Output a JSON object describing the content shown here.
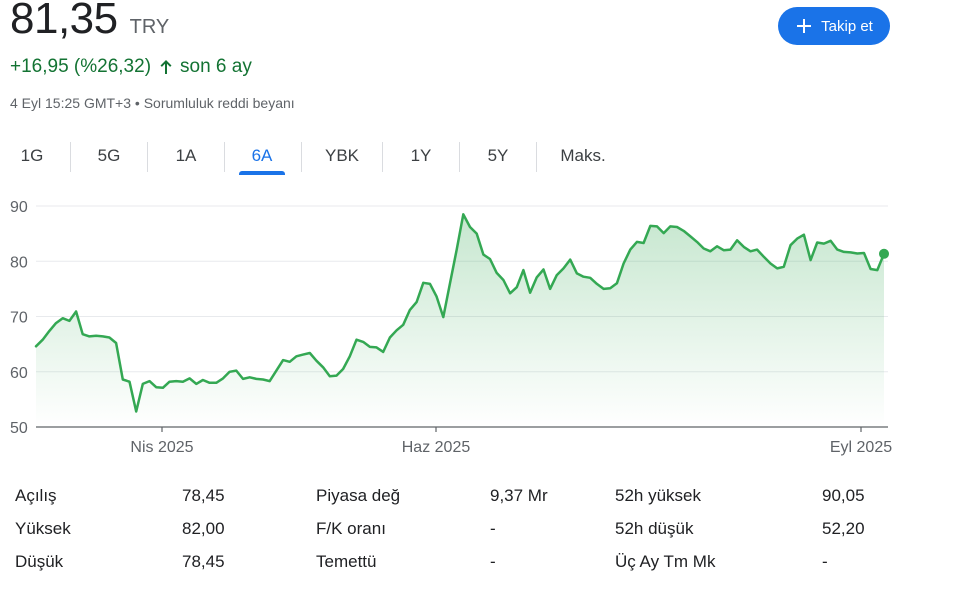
{
  "quote": {
    "price": "81,35",
    "currency": "TRY",
    "change": "+16,95 (%26,32)",
    "period": "son 6 ay",
    "timestamp": "4 Eyl 15:25 GMT+3",
    "separator": "•",
    "disclaimer": "Sorumluluk reddi beyanı",
    "change_color": "#137333",
    "change_icon": "arrow-up-icon"
  },
  "follow_button": {
    "label": "Takip et",
    "icon": "plus-icon",
    "color": "#1a73e8"
  },
  "tabs": [
    {
      "label": "1G",
      "active": false
    },
    {
      "label": "5G",
      "active": false
    },
    {
      "label": "1A",
      "active": false
    },
    {
      "label": "6A",
      "active": true
    },
    {
      "label": "YBK",
      "active": false
    },
    {
      "label": "1Y",
      "active": false
    },
    {
      "label": "5Y",
      "active": false
    },
    {
      "label": "Maks.",
      "active": false
    }
  ],
  "chart_data": {
    "type": "area",
    "y_ticks": [
      "90",
      "80",
      "70",
      "60",
      "50"
    ],
    "ylim": [
      50,
      90
    ],
    "x_tick_labels": [
      "Nis 2025",
      "Haz 2025",
      "Eyl 2025"
    ],
    "grid": true,
    "line_color": "#34a853",
    "values": [
      64.6,
      65.8,
      67.4,
      68.8,
      69.7,
      69.2,
      70.9,
      66.8,
      66.4,
      66.5,
      66.4,
      66.2,
      65.2,
      58.6,
      58.2,
      52.8,
      57.8,
      58.3,
      57.2,
      57.1,
      58.2,
      58.3,
      58.2,
      58.8,
      57.8,
      58.5,
      58.0,
      58.0,
      58.8,
      60.0,
      60.2,
      58.7,
      59.0,
      58.7,
      58.6,
      58.3,
      60.2,
      62.1,
      61.8,
      62.8,
      63.1,
      63.4,
      62.0,
      60.8,
      59.2,
      59.3,
      60.5,
      62.8,
      65.8,
      65.4,
      64.5,
      64.4,
      63.6,
      66.2,
      67.5,
      68.5,
      71.2,
      72.6,
      76.1,
      75.9,
      73.6,
      69.9,
      76.0,
      82.1,
      88.5,
      86.2,
      85.0,
      81.2,
      80.4,
      77.9,
      76.6,
      74.2,
      75.3,
      78.4,
      74.3,
      77.1,
      78.5,
      75.0,
      77.5,
      78.7,
      80.3,
      77.8,
      77.2,
      77.0,
      75.9,
      75.0,
      75.1,
      76.0,
      79.6,
      82.1,
      83.5,
      83.3,
      86.4,
      86.3,
      85.1,
      86.3,
      86.2,
      85.5,
      84.5,
      83.5,
      82.3,
      81.8,
      82.7,
      82.0,
      82.1,
      83.8,
      82.6,
      81.8,
      82.1,
      80.8,
      79.6,
      78.7,
      79.0,
      82.9,
      84.1,
      84.8,
      80.2,
      83.4,
      83.2,
      83.7,
      82.1,
      81.7,
      81.6,
      81.4,
      81.5,
      78.6,
      78.4,
      81.35
    ],
    "last_value": 81.35
  },
  "stats": [
    {
      "label": "Açılış",
      "value": "78,45",
      "label2": "Piyasa değ",
      "value2": "9,37 Mr",
      "label3": "52h yüksek",
      "value3": "90,05"
    },
    {
      "label": "Yüksek",
      "value": "82,00",
      "label2": "F/K oranı",
      "value2": "-",
      "label3": "52h düşük",
      "value3": "52,20"
    },
    {
      "label": "Düşük",
      "value": "78,45",
      "label2": "Temettü",
      "value2": "-",
      "label3": "Üç Ay Tm Mk",
      "value3": "-"
    }
  ]
}
